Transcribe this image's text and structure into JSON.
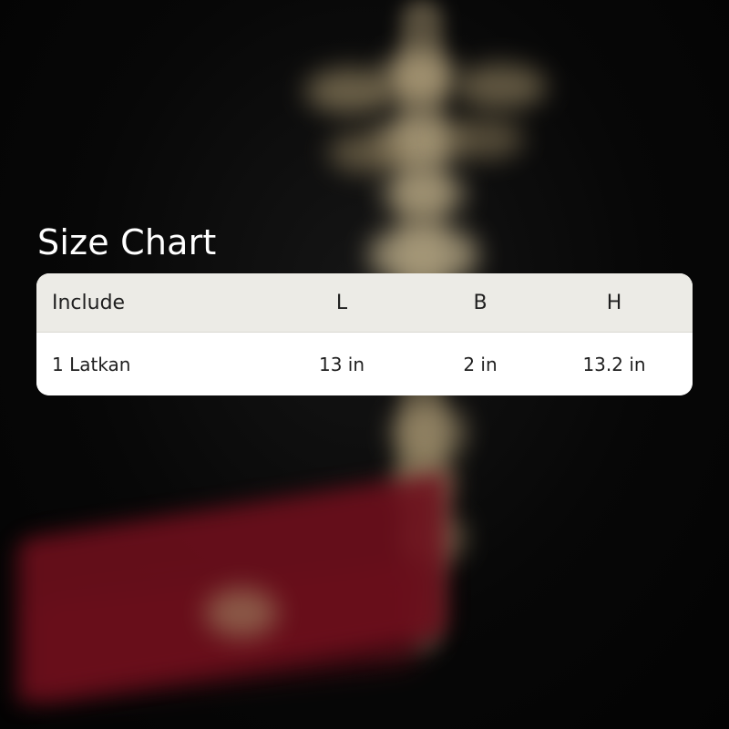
{
  "title": "Size Chart",
  "table": {
    "headers": [
      "Include",
      "L",
      "B",
      "H"
    ],
    "rows": [
      [
        "1 Latkan",
        "13 in",
        "2 in",
        "13.2 in"
      ]
    ]
  },
  "colors": {
    "header_bg": "#ecebe6",
    "row_bg": "#ffffff",
    "text": "#1f1f1f",
    "title": "#ffffff",
    "background": "#050505"
  }
}
